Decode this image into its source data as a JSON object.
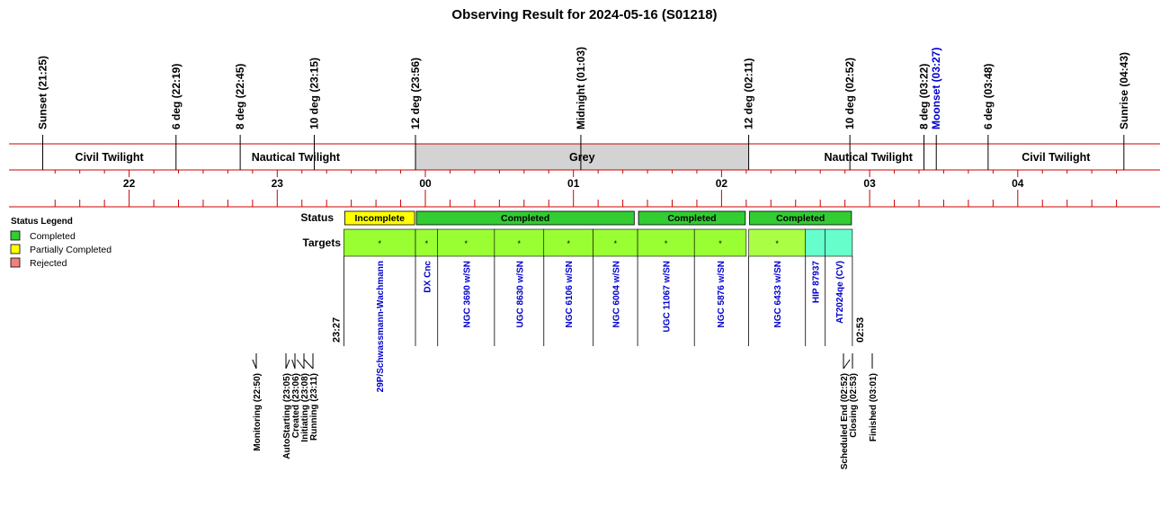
{
  "title": "Observing Result for 2024-05-16 (S01218)",
  "colors": {
    "grid_line": "#cc0000",
    "grey_band": "#d3d3d3",
    "completed": "#33cc33",
    "incomplete": "#ffff00",
    "rejected": "#f08080",
    "target_green": "#99ff33",
    "target_lime": "#aaff44",
    "target_cyan": "#66ffcc",
    "target_text": "#0000cc",
    "moon_text": "#0000cc"
  },
  "legend": {
    "title": "Status Legend",
    "items": [
      {
        "label": "Completed",
        "color": "#33cc33"
      },
      {
        "label": "Partially Completed",
        "color": "#ffff00"
      },
      {
        "label": "Rejected",
        "color": "#f08080"
      }
    ]
  },
  "row_labels": {
    "status": "Status",
    "targets": "Targets"
  },
  "chart_data": {
    "type": "timeline",
    "title": "Observing Result for 2024-05-16 (S01218)",
    "x_axis": {
      "unit": "UT hour",
      "range": [
        "21:25",
        "04:43"
      ],
      "tick_labels": [
        "22",
        "23",
        "00",
        "01",
        "02",
        "03",
        "04"
      ]
    },
    "sun_events": [
      {
        "label": "Sunset (21:25)",
        "time": "21:25"
      },
      {
        "label": "6 deg (22:19)",
        "time": "22:19"
      },
      {
        "label": "8 deg (22:45)",
        "time": "22:45"
      },
      {
        "label": "10 deg (23:15)",
        "time": "23:15"
      },
      {
        "label": "12 deg (23:56)",
        "time": "23:56"
      },
      {
        "label": "Midnight (01:03)",
        "time": "01:03"
      },
      {
        "label": "12 deg (02:11)",
        "time": "02:11"
      },
      {
        "label": "10 deg (02:52)",
        "time": "02:52"
      },
      {
        "label": "8 deg (03:22)",
        "time": "03:22"
      },
      {
        "label": "Moonset (03:27)",
        "time": "03:27",
        "moon": true
      },
      {
        "label": "6 deg (03:48)",
        "time": "03:48"
      },
      {
        "label": "Sunrise (04:43)",
        "time": "04:43"
      }
    ],
    "twilight_bands": [
      {
        "label": "Civil Twilight",
        "start": "21:25",
        "end": "22:19"
      },
      {
        "label": "Nautical Twilight",
        "start": "22:19",
        "end": "23:56"
      },
      {
        "label": "Grey",
        "start": "23:56",
        "end": "02:11",
        "shaded": true
      },
      {
        "label": "Nautical Twilight",
        "start": "02:11",
        "end": "03:48"
      },
      {
        "label": "Civil Twilight",
        "start": "03:48",
        "end": "04:43"
      }
    ],
    "status_blocks": [
      {
        "label": "Incomplete",
        "start": "23:27",
        "end": "23:56",
        "status": "incomplete"
      },
      {
        "label": "Completed",
        "start": "23:56",
        "end": "01:25",
        "status": "completed"
      },
      {
        "label": "Completed",
        "start": "01:26",
        "end": "02:10",
        "status": "completed"
      },
      {
        "label": "Completed",
        "start": "02:11",
        "end": "02:53",
        "status": "completed"
      }
    ],
    "targets": [
      {
        "name": "29P/Schwassmann-Wachmann",
        "start": "23:27",
        "end": "23:56",
        "marker": "*",
        "color": "green"
      },
      {
        "name": "DX Cnc",
        "start": "23:56",
        "end": "24:05",
        "marker": "*",
        "color": "green"
      },
      {
        "name": "NGC 3690 w/SN",
        "start": "24:05",
        "end": "24:28",
        "marker": "*",
        "color": "green"
      },
      {
        "name": "UGC 8630 w/SN",
        "start": "24:28",
        "end": "24:48",
        "marker": "*",
        "color": "green"
      },
      {
        "name": "NGC 6106 w/SN",
        "start": "24:48",
        "end": "25:08",
        "marker": "*",
        "color": "green"
      },
      {
        "name": "NGC 6004 w/SN",
        "start": "25:08",
        "end": "25:26",
        "marker": "*",
        "color": "green"
      },
      {
        "name": "UGC 11067 w/SN",
        "start": "25:26",
        "end": "25:49",
        "marker": "*",
        "color": "green"
      },
      {
        "name": "NGC 5876 w/SN",
        "start": "25:49",
        "end": "26:10",
        "marker": "*",
        "color": "green"
      },
      {
        "name": "NGC 6433 w/SN",
        "start": "26:11",
        "end": "26:34",
        "marker": "*",
        "color": "lime"
      },
      {
        "name": "HIP 87937",
        "start": "26:34",
        "end": "26:42",
        "marker": "",
        "color": "cyan"
      },
      {
        "name": "AT2024qe (CV)",
        "start": "26:42",
        "end": "26:53",
        "marker": "",
        "color": "cyan"
      }
    ],
    "start_label": "23:27",
    "end_label": "02:53",
    "events": [
      {
        "label": "Monitoring (22:50)",
        "time": "22:50"
      },
      {
        "label": "AutoStarting (23:05)",
        "time": "23:05"
      },
      {
        "label": "Created (23:06)",
        "time": "23:06"
      },
      {
        "label": "Initiating (23:08)",
        "time": "23:08"
      },
      {
        "label": "Running (23:11)",
        "time": "23:11"
      },
      {
        "label": "Scheduled End (02:52)",
        "time": "02:52"
      },
      {
        "label": "Closing (02:53)",
        "time": "02:53"
      },
      {
        "label": "Finished (03:01)",
        "time": "03:01"
      }
    ]
  }
}
